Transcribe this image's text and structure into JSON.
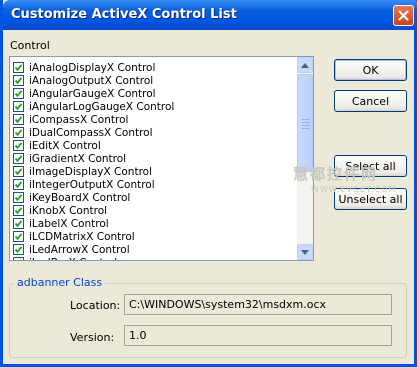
{
  "window": {
    "title": "Customize ActiveX Control List"
  },
  "list": {
    "label": "Control",
    "items": [
      {
        "label": "iAnalogDisplayX Control",
        "checked": true
      },
      {
        "label": "iAnalogOutputX Control",
        "checked": true
      },
      {
        "label": "iAngularGaugeX Control",
        "checked": true
      },
      {
        "label": "iAngularLogGaugeX Control",
        "checked": true
      },
      {
        "label": "iCompassX Control",
        "checked": true
      },
      {
        "label": "iDualCompassX Control",
        "checked": true
      },
      {
        "label": "iEditX Control",
        "checked": true
      },
      {
        "label": "iGradientX Control",
        "checked": true
      },
      {
        "label": "iImageDisplayX Control",
        "checked": true
      },
      {
        "label": "iIntegerOutputX Control",
        "checked": true
      },
      {
        "label": "iKeyBoardX Control",
        "checked": true
      },
      {
        "label": "iKnobX Control",
        "checked": true
      },
      {
        "label": "iLabelX Control",
        "checked": true
      },
      {
        "label": "iLCDMatrixX Control",
        "checked": true
      },
      {
        "label": "iLedArrowX Control",
        "checked": true
      },
      {
        "label": "iLedBarX Control",
        "checked": true
      }
    ]
  },
  "buttons": {
    "ok": "OK",
    "cancel": "Cancel",
    "select_all": "Select all",
    "unselect_all": "Unselect all"
  },
  "watermark": {
    "text": "慧都控件网",
    "sub": "WWW.EVGET.COM"
  },
  "details": {
    "group_title": "adbanner Class",
    "location_label": "Location:",
    "location_value": "C:\\WINDOWS\\system32\\msdxm.ocx",
    "version_label": "Version:",
    "version_value": "1.0"
  },
  "colors": {
    "titlebar": "#0055e5",
    "group_title": "#0046d5",
    "check_mark": "#21a121"
  }
}
